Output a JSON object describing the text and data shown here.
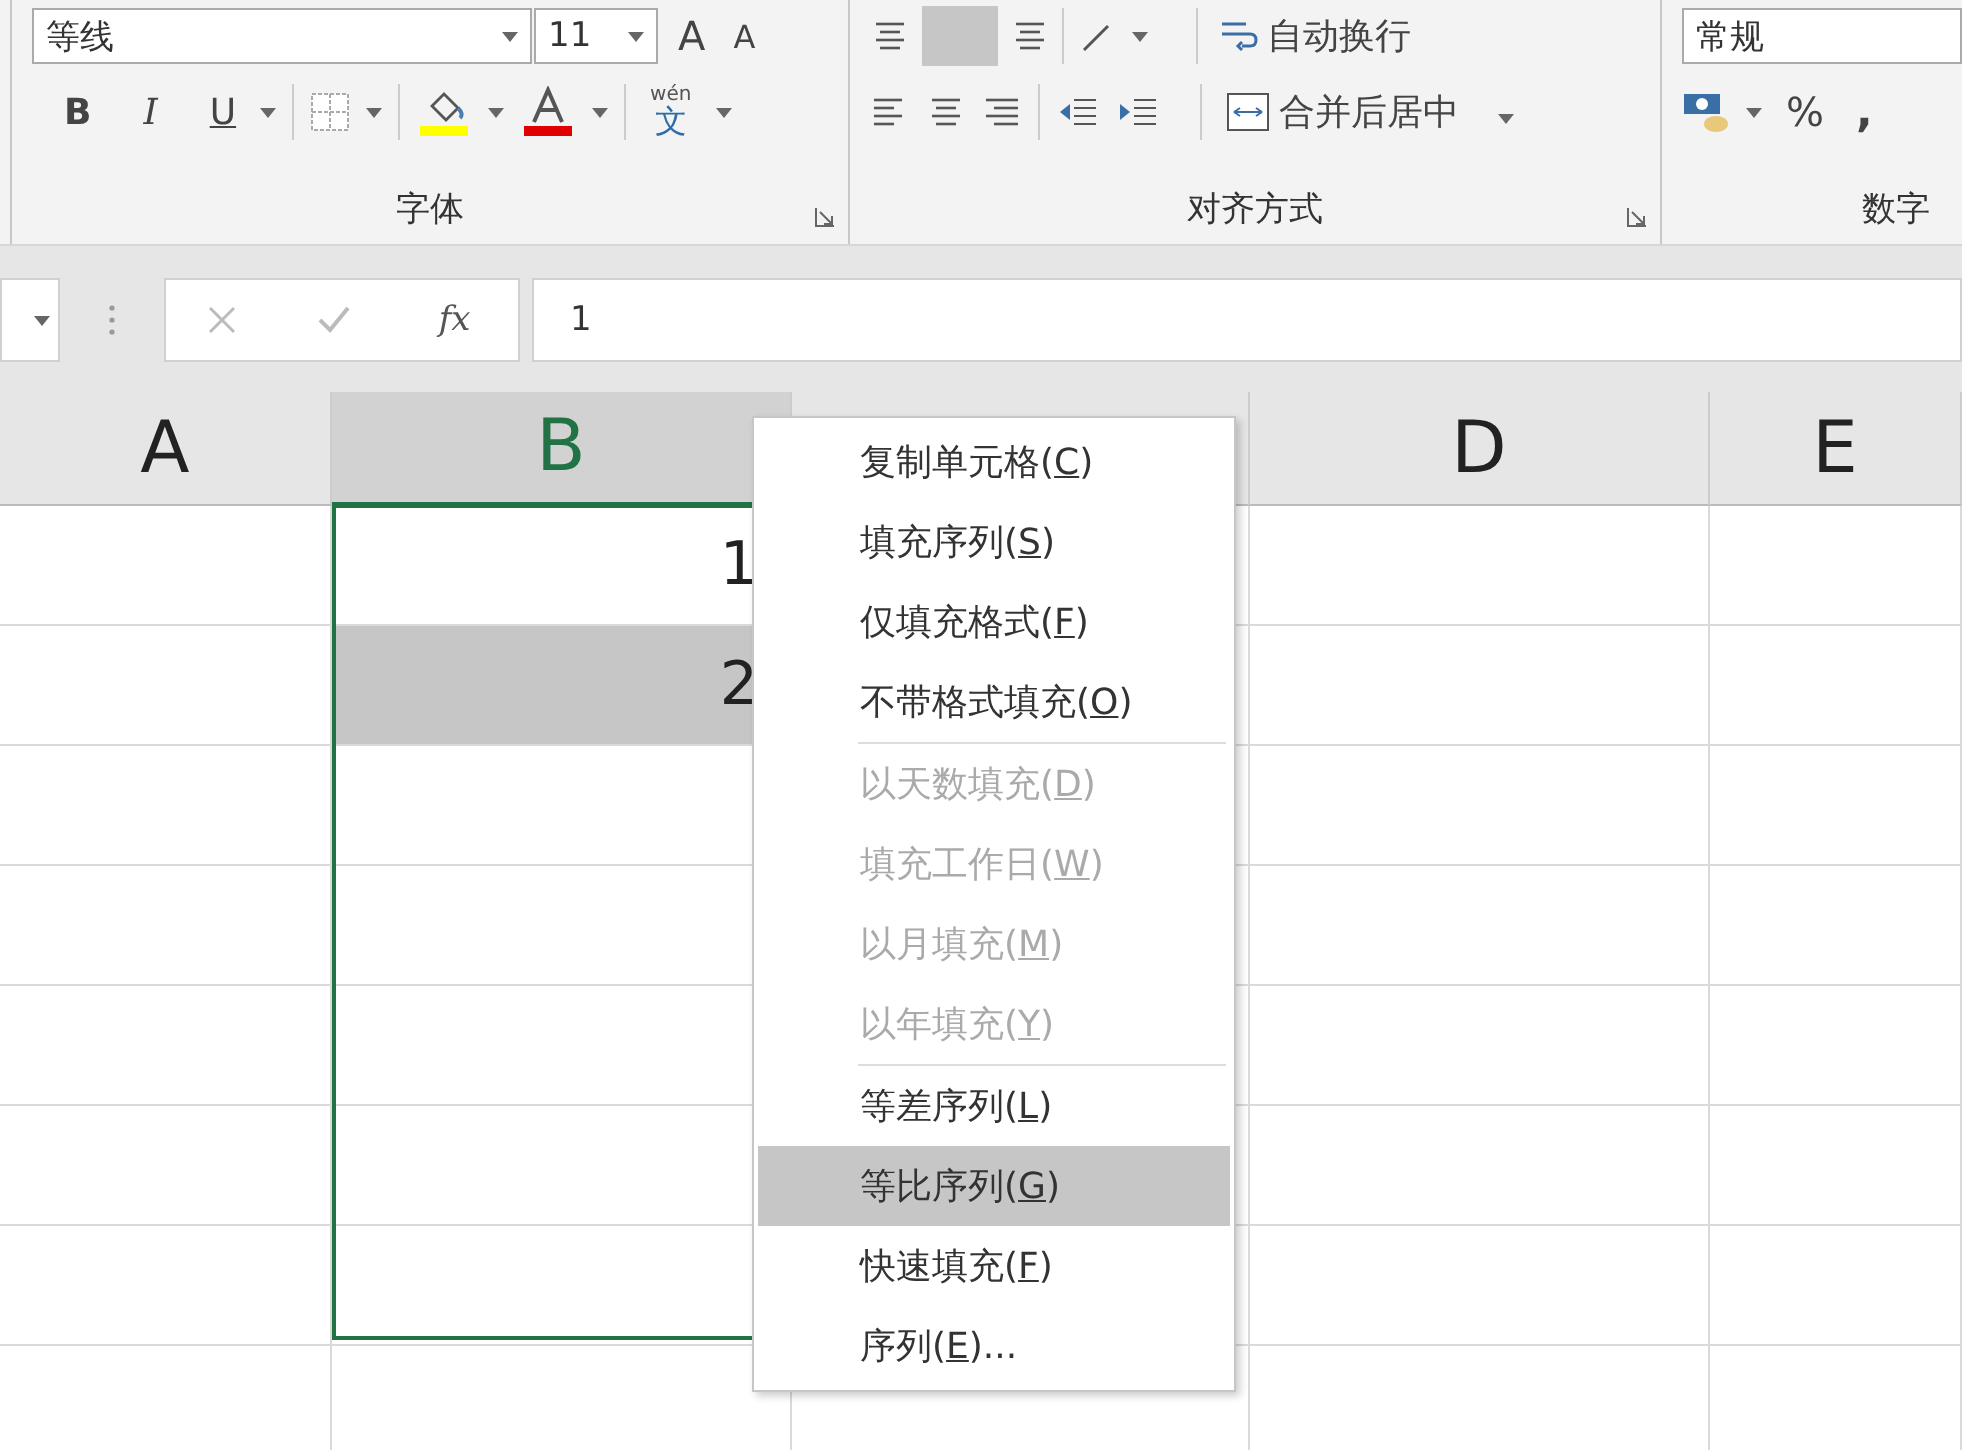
{
  "ribbon": {
    "font": {
      "font_name": "等线",
      "font_size": "11",
      "grow_font": "A",
      "shrink_font": "A",
      "bold": "B",
      "italic": "I",
      "underline": "U",
      "pinyin_top": "wén",
      "pinyin_char": "文",
      "label": "字体"
    },
    "alignment": {
      "wrap_text": "自动换行",
      "merge_center": "合并后居中",
      "label": "对齐方式"
    },
    "number": {
      "format": "常规",
      "percent": "%",
      "comma": ",",
      "label": "数字"
    }
  },
  "formula_bar": {
    "fx": "fx",
    "value": "1"
  },
  "sheet": {
    "columns": [
      {
        "label": "A",
        "selected": false
      },
      {
        "label": "B",
        "selected": true
      },
      {
        "selected": false
      },
      {
        "label": "D",
        "selected": false
      },
      {
        "label": "E",
        "selected": false
      }
    ],
    "b_cells": [
      {
        "value": "1",
        "highlighted": false
      },
      {
        "value": "2",
        "highlighted": true
      }
    ]
  },
  "context_menu": {
    "groups": [
      [
        {
          "before": "复制单元格(",
          "key": "C",
          "after": ")",
          "disabled": false,
          "selected": false
        },
        {
          "before": "填充序列(",
          "key": "S",
          "after": ")",
          "disabled": false,
          "selected": false
        },
        {
          "before": "仅填充格式(",
          "key": "F",
          "after": ")",
          "disabled": false,
          "selected": false
        },
        {
          "before": "不带格式填充(",
          "key": "O",
          "after": ")",
          "disabled": false,
          "selected": false
        }
      ],
      [
        {
          "before": "以天数填充(",
          "key": "D",
          "after": ")",
          "disabled": true,
          "selected": false
        },
        {
          "before": "填充工作日(",
          "key": "W",
          "after": ")",
          "disabled": true,
          "selected": false
        },
        {
          "before": "以月填充(",
          "key": "M",
          "after": ")",
          "disabled": true,
          "selected": false
        },
        {
          "before": "以年填充(",
          "key": "Y",
          "after": ")",
          "disabled": true,
          "selected": false
        }
      ],
      [
        {
          "before": "等差序列(",
          "key": "L",
          "after": ")",
          "disabled": false,
          "selected": false
        },
        {
          "before": "等比序列(",
          "key": "G",
          "after": ")",
          "disabled": false,
          "selected": true
        },
        {
          "before": "快速填充(",
          "key": "F",
          "after": ")",
          "disabled": false,
          "selected": false
        },
        {
          "before": "序列(",
          "key": "E",
          "after": ")...",
          "disabled": false,
          "selected": false
        }
      ]
    ]
  }
}
